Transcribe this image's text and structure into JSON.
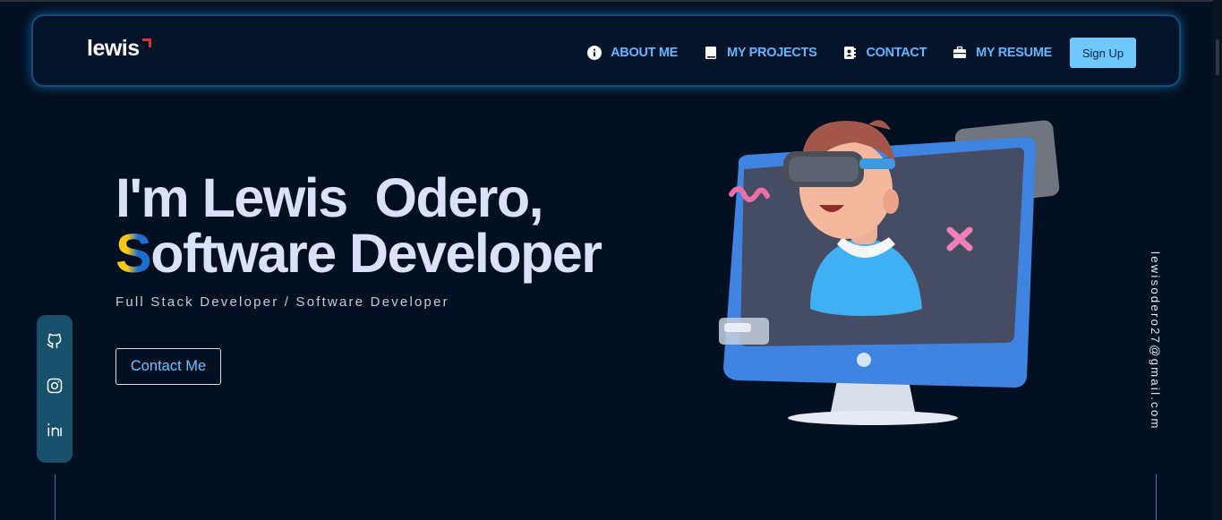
{
  "brand": {
    "logo_text": "lewis"
  },
  "nav": {
    "items": [
      {
        "label": "ABOUT ME",
        "icon": "info-circle-icon"
      },
      {
        "label": "MY PROJECTS",
        "icon": "book-icon"
      },
      {
        "label": "CONTACT",
        "icon": "address-book-icon"
      },
      {
        "label": "MY RESUME",
        "icon": "briefcase-icon"
      }
    ],
    "signup_label": "Sign Up"
  },
  "hero": {
    "title_line1": "I'm Lewis  Odero,",
    "title_line2_first": "S",
    "title_line2_rest": "oftware Developer",
    "subtitle": "Full Stack Developer / Software Developer",
    "cta_label": "Contact Me"
  },
  "social": {
    "icons": [
      "github-icon",
      "instagram-icon",
      "linkedin-icon"
    ]
  },
  "email": "lewisodero27@gmail.com",
  "colors": {
    "background": "#031022",
    "accent": "#63b7ff",
    "signup_bg": "#6fc8fb",
    "logo_mark": "#e03030",
    "title": "#dce1fb"
  }
}
